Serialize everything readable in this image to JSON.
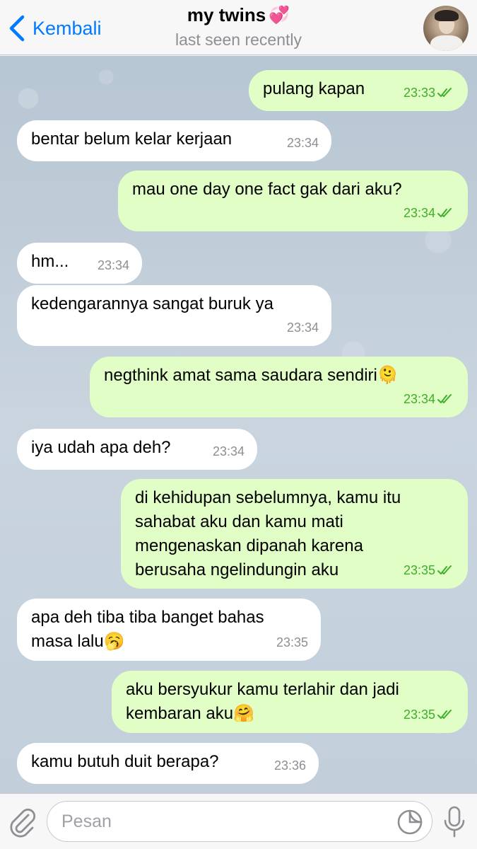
{
  "header": {
    "back_label": "Kembali",
    "title": "my twins",
    "title_emoji": "💞",
    "subtitle": "last seen recently"
  },
  "messages": [
    {
      "dir": "out",
      "text": "pulang kapan",
      "time": "23:33"
    },
    {
      "dir": "in",
      "text": "bentar belum kelar kerjaan",
      "time": "23:34"
    },
    {
      "dir": "out",
      "text": "mau one day one fact gak dari aku?",
      "time": "23:34"
    },
    {
      "dir": "in",
      "text": "hm...",
      "time": "23:34"
    },
    {
      "dir": "in",
      "text": "kedengarannya sangat buruk ya",
      "time": "23:34"
    },
    {
      "dir": "out",
      "text": "negthink amat sama saudara sendiri",
      "emoji": "🫠",
      "time": "23:34"
    },
    {
      "dir": "in",
      "text": "iya udah apa deh?",
      "time": "23:34"
    },
    {
      "dir": "out",
      "text": "di kehidupan sebelumnya, kamu itu\nsahabat aku dan kamu mati\nmengenaskan dipanah karena\nberusaha ngelindungin aku",
      "time": "23:35"
    },
    {
      "dir": "in",
      "text": "apa deh tiba tiba banget bahas\nmasa lalu",
      "emoji": "🥱",
      "time": "23:35"
    },
    {
      "dir": "out",
      "text": "aku bersyukur kamu terlahir dan jadi\nkembaran aku",
      "emoji": "🤗",
      "time": "23:35"
    },
    {
      "dir": "in",
      "text": "kamu butuh duit berapa?",
      "time": "23:36"
    }
  ],
  "input": {
    "placeholder": "Pesan"
  },
  "colors": {
    "accent": "#007aff",
    "outgoing_bubble": "#e1fec6",
    "incoming_bubble": "#ffffff",
    "outgoing_time": "#3fae2a",
    "incoming_time": "#8e8e93"
  },
  "icons": {
    "back": "chevron-left-icon",
    "attach": "paperclip-icon",
    "sticker": "sticker-icon",
    "mic": "microphone-icon",
    "read_receipt": "double-check-icon"
  }
}
